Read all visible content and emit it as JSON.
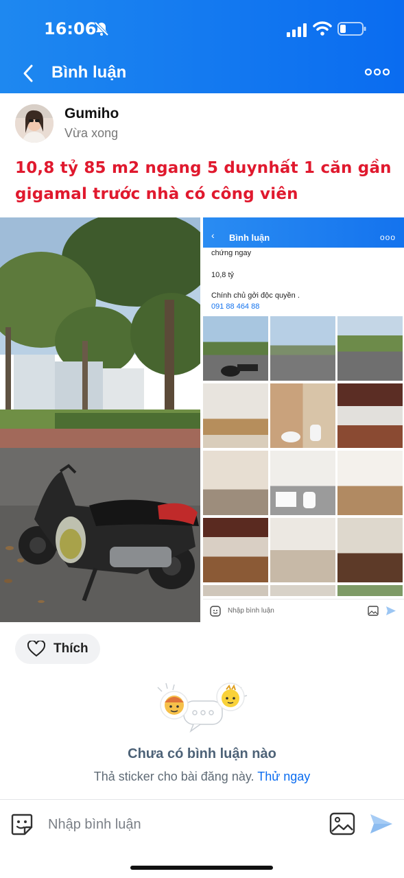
{
  "status_bar": {
    "time": "16:06"
  },
  "nav": {
    "title": "Bình luận"
  },
  "post": {
    "author": "Gumiho",
    "time": "Vừa xong",
    "text_line1": "10,8 tỷ 85 m2 ngang 5 duynhất 1 căn gần",
    "text_line2": "gigamal trước nhà có công viên",
    "text_color": "#e0192e"
  },
  "embedded_screenshot": {
    "title": "Bình luận",
    "line1": "chứng ngay",
    "line2": "10,8 tỷ",
    "line3": "Chính chủ gởi độc quyền .",
    "phone": "091 88 464 88",
    "compose_placeholder": "Nhập bình luận"
  },
  "like": {
    "label": "Thích"
  },
  "empty_state": {
    "title": "Chưa có bình luận nào",
    "subtitle": "Thả sticker cho bài đăng này.",
    "link": "Thử ngay"
  },
  "composer": {
    "placeholder": "Nhập bình luận"
  },
  "colors": {
    "header_blue": "#0a6cf0",
    "link_blue": "#0a6cf0",
    "empty_title": "#4d6277"
  },
  "icons": {
    "status": [
      "bell-off-icon",
      "signal-icon",
      "wifi-icon",
      "battery-icon"
    ],
    "nav": [
      "back-icon",
      "more-icon"
    ],
    "post": [
      "heart-icon"
    ],
    "composer": [
      "sticker-icon",
      "image-icon",
      "send-icon"
    ]
  }
}
